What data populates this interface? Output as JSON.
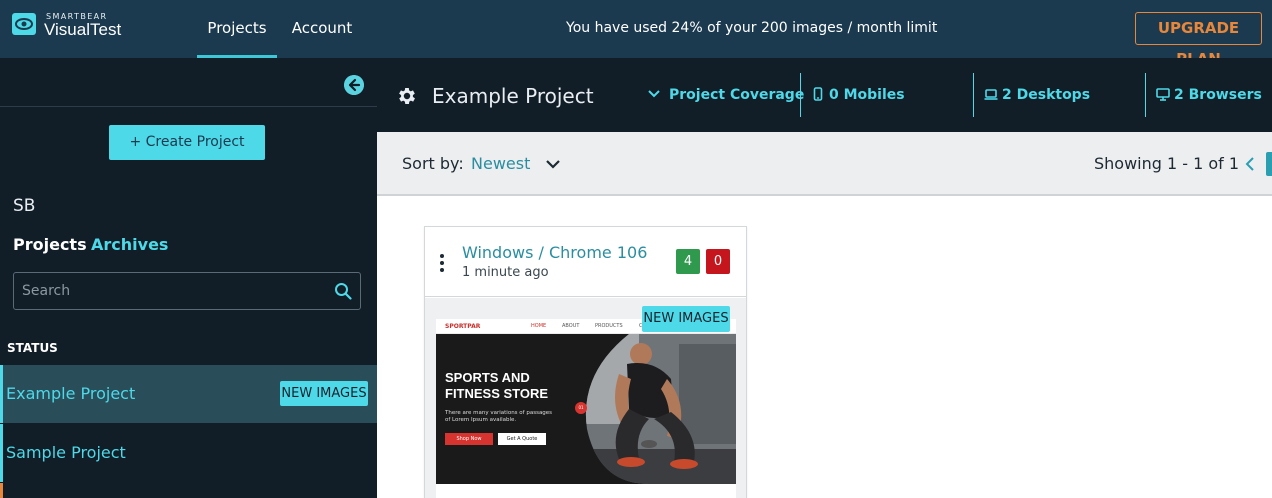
{
  "brand": {
    "small": "SMARTBEAR",
    "name": "VisualTest"
  },
  "nav": {
    "projects": "Projects",
    "account": "Account"
  },
  "usage_text": "You have used 24% of your 200 images / month limit",
  "upgrade_label": "UPGRADE PLAN",
  "sidebar": {
    "create_label": "+ Create Project",
    "org": "SB",
    "tabs": {
      "projects": "Projects",
      "archives": "Archives"
    },
    "search_placeholder": "Search",
    "status_label": "STATUS",
    "projects": [
      {
        "name": "Example Project",
        "badge": "NEW IMAGES"
      },
      {
        "name": "Sample Project"
      }
    ]
  },
  "header": {
    "title": "Example Project",
    "coverage": "Project Coverage",
    "mobiles": "0 Mobiles",
    "desktops": "2 Desktops",
    "browsers": "2 Browsers"
  },
  "sort": {
    "label": "Sort by:",
    "value": "Newest"
  },
  "pagination": {
    "showing": "Showing 1 - 1 of 1"
  },
  "card": {
    "title": "Windows / Chrome 106",
    "time": "1 minute ago",
    "pass_count": "4",
    "fail_count": "0",
    "badge": "NEW IMAGES",
    "thumbnail": {
      "brand": "SPORTPAR",
      "nav": [
        "HOME",
        "ABOUT",
        "PRODUCTS",
        "C"
      ],
      "headline_1": "SPORTS AND",
      "headline_2": "FITNESS STORE",
      "body": "There are many variations of passages of Lorem Ipsum available.",
      "btn_primary": "Shop Now",
      "btn_secondary": "Get A Quote",
      "dot": "01"
    }
  },
  "colors": {
    "topbar": "#1b3a4f",
    "sidebar": "#111d27",
    "accent": "#4dd9e8",
    "upgrade": "#e6873b",
    "pass": "#2f9a4e",
    "fail": "#c4161c"
  }
}
